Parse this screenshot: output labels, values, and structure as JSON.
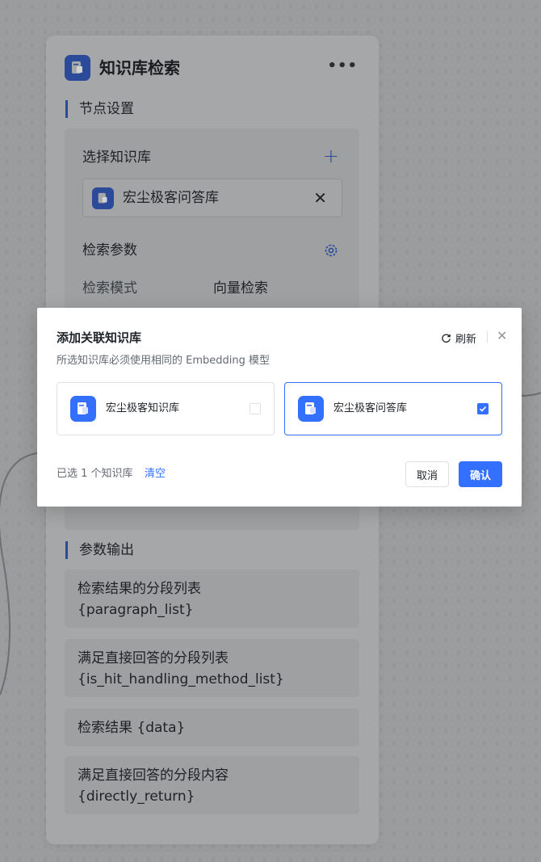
{
  "node": {
    "title": "知识库检索",
    "more_label": "•••",
    "settings_section": "节点设置",
    "select_kb_label": "选择知识库",
    "add_label": "+",
    "selected_kb_name": "宏尘极客问答库",
    "remove_label": "✕",
    "search_params_label": "检索参数",
    "search_mode_label": "检索模式",
    "search_mode_value": "向量检索",
    "output_section": "参数输出",
    "outputs": [
      {
        "label": "检索结果的分段列表",
        "var": "{paragraph_list}"
      },
      {
        "label": "满足直接回答的分段列表",
        "var": "{is_hit_handling_method_list}"
      },
      {
        "label": "检索结果 {data}",
        "var": ""
      },
      {
        "label": "满足直接回答的分段内容",
        "var": "{directly_return}"
      }
    ]
  },
  "modal": {
    "title": "添加关联知识库",
    "subtitle": "所选知识库必须使用相同的 Embedding 模型",
    "refresh_label": "刷新",
    "close_label": "✕",
    "knowledge_bases": [
      {
        "name": "宏尘极客知识库",
        "checked": false
      },
      {
        "name": "宏尘极客问答库",
        "checked": true
      }
    ],
    "selected_info": "已选 1 个知识库",
    "clear_label": "清空",
    "cancel_label": "取消",
    "confirm_label": "确认"
  },
  "colors": {
    "accent": "#3370ff",
    "node_accent_dimmed": "#2c4a9a"
  }
}
